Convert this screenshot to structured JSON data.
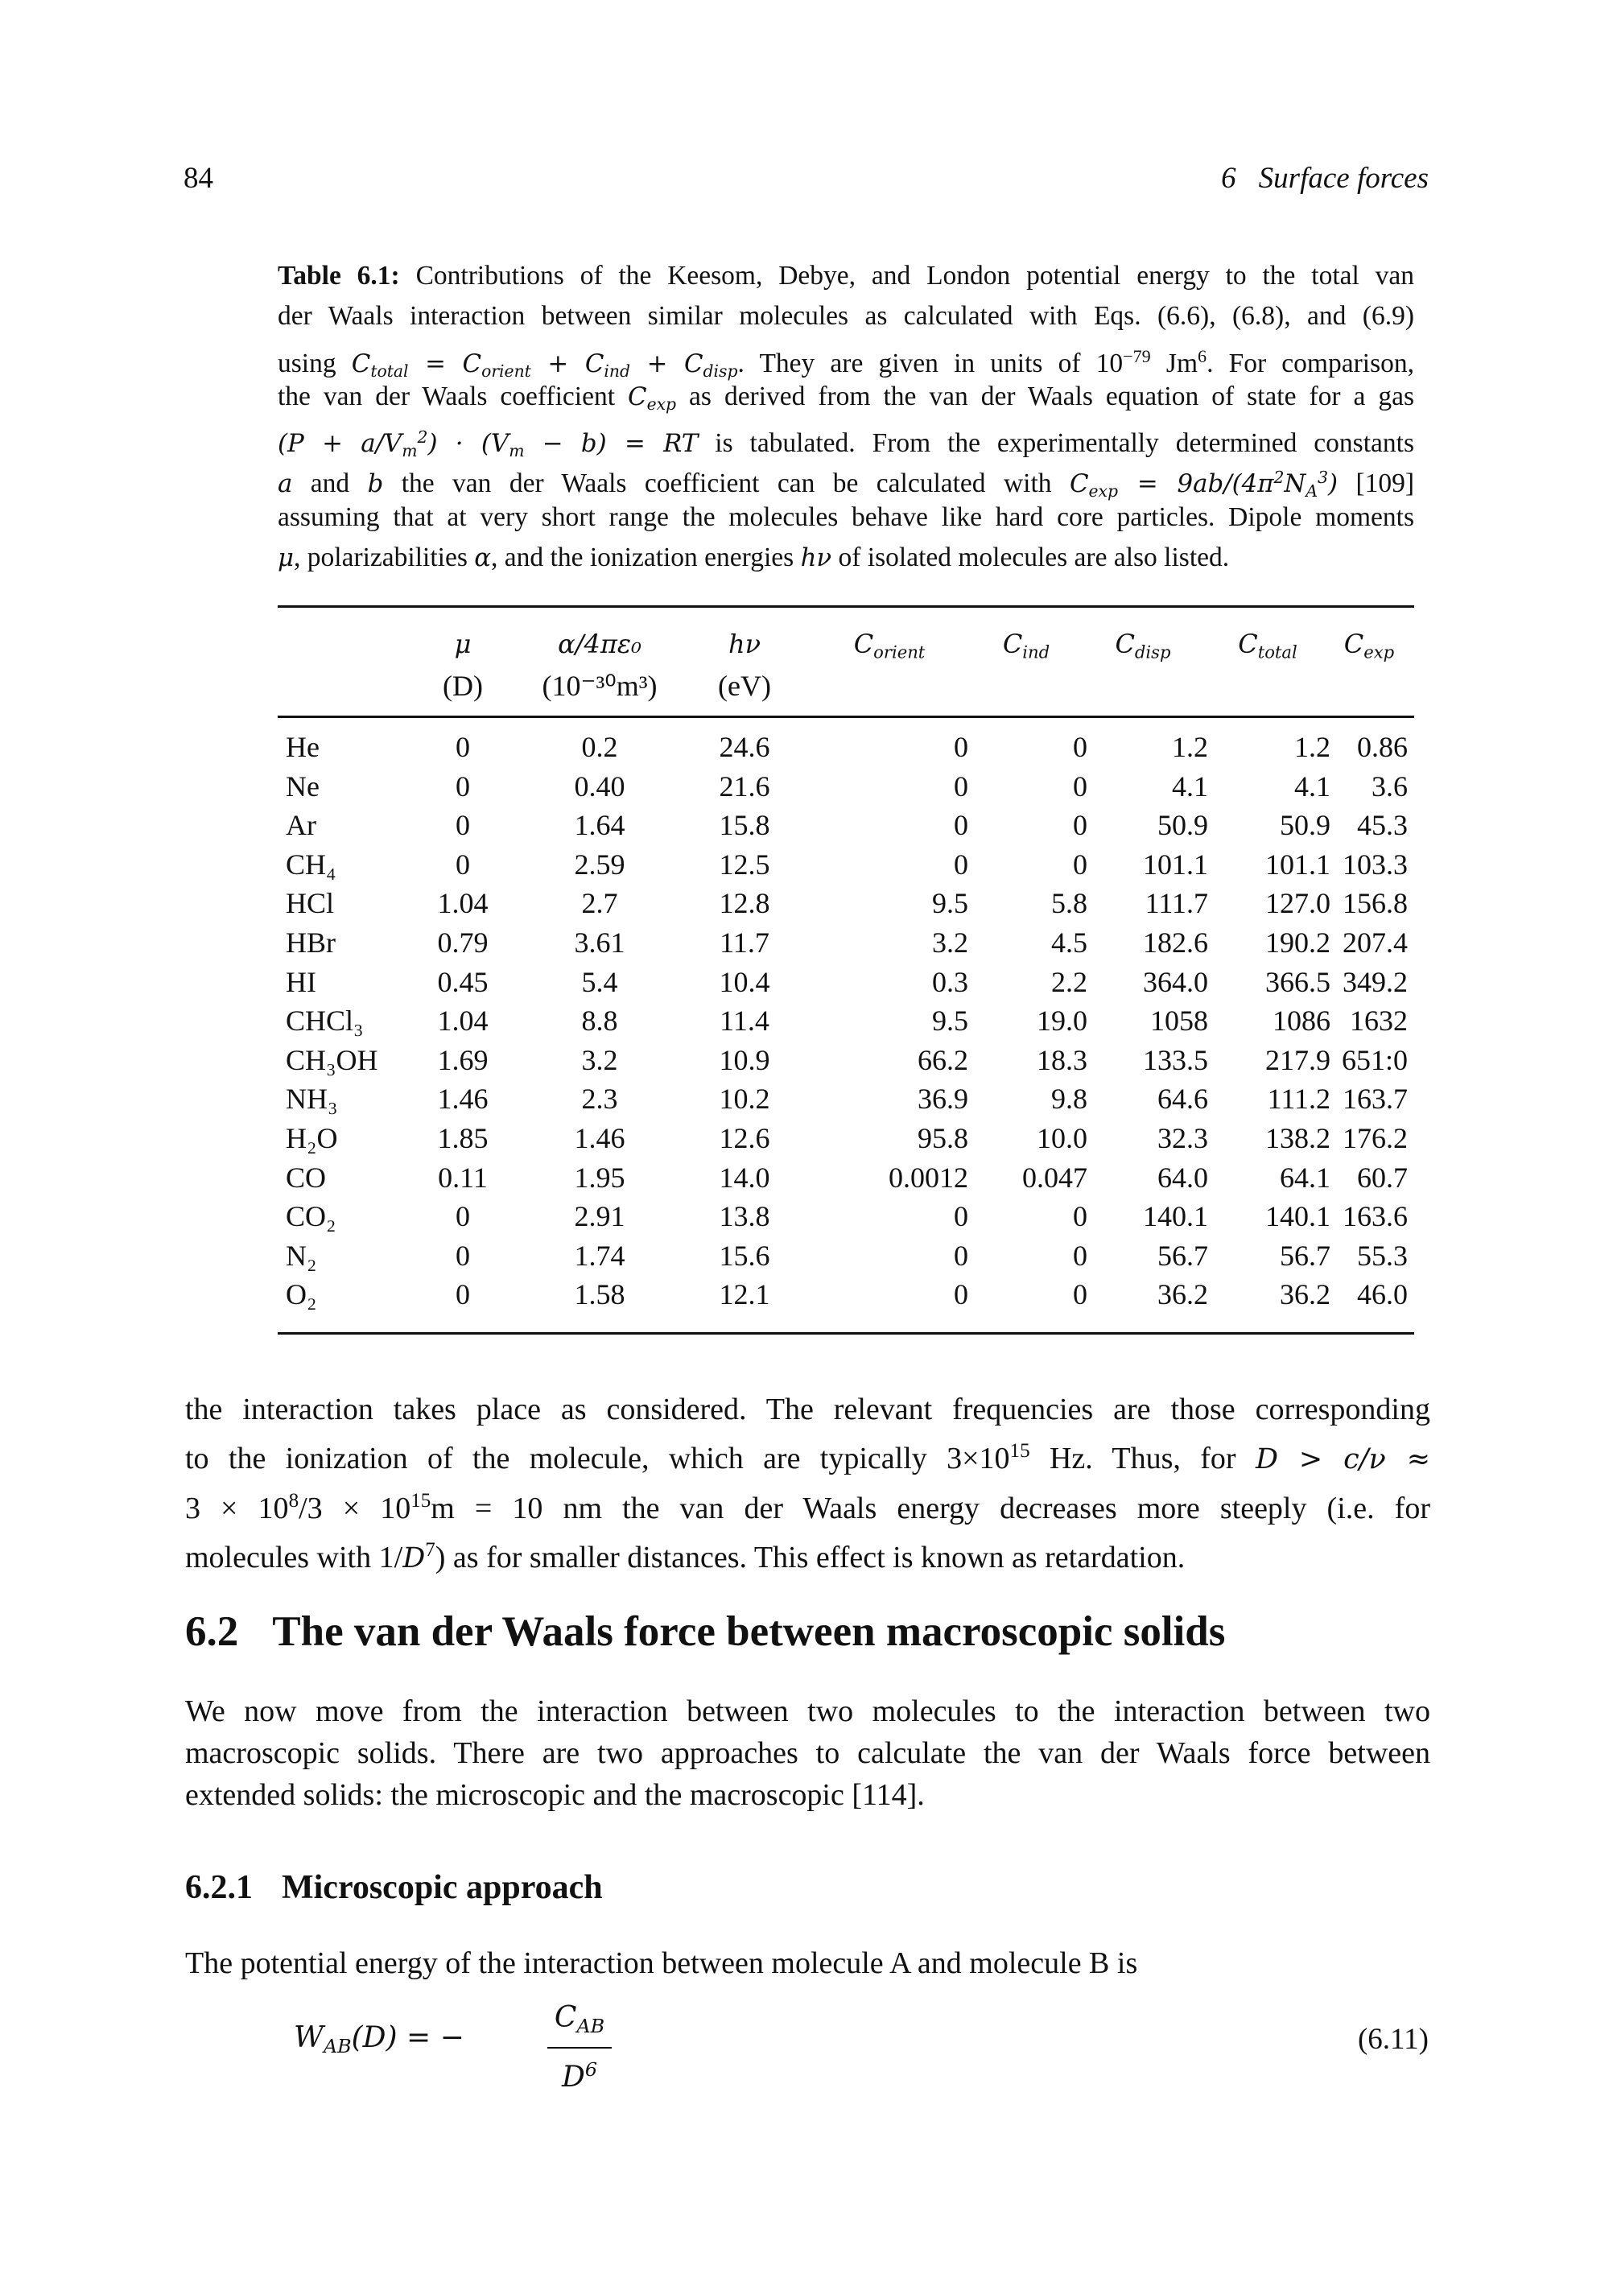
{
  "header": {
    "page_number": "84",
    "chapter_number": "6",
    "chapter_title": "Surface forces"
  },
  "caption": {
    "label": "Table 6.1:",
    "lines": [
      "Contributions of the Keesom, Debye, and London potential energy to the total van",
      "der Waals interaction between similar molecules as calculated with Eqs. (6.6), (6.8), and (6.9)",
      "using C_total = C_orient + C_ind + C_disp. They are given in units of 10^−79 Jm^6. For comparison,",
      "the van der Waals coefficient C_exp as derived from the van der Waals equation of state for a gas",
      "(P + a/V_m^2) · (V_m − b) = RT is tabulated. From the experimentally determined constants",
      "a and b the van der Waals coefficient can be calculated with C_exp = 9ab/(4π^2 N_A^3) [109]",
      "assuming that at very short range the molecules behave like hard core particles. Dipole moments",
      "μ, polarizabilities α, and the ionization energies hν of isolated molecules are also listed."
    ],
    "parts": {
      "l3_a": "using ",
      "l3_b": ". They are given in units of 10",
      "l3_exp1": "−79",
      "l3_c": " Jm",
      "l3_exp2": "6",
      "l3_d": ". For comparison,",
      "l4_a": "the van der Waals coefficient ",
      "l4_b": " as derived from the van der Waals equation of state for a gas",
      "l5_b": " is tabulated.  From the experimentally determined constants",
      "l6_a": " and ",
      "l6_b": " the van der Waals coefficient can be calculated with ",
      "l6_c": " [109]",
      "l7": "assuming that at very short range the molecules behave like hard core particles. Dipole moments",
      "l8_a": ", polarizabilities ",
      "l8_b": ", and the ionization energies ",
      "l8_c": " of isolated molecules are also listed."
    }
  },
  "table": {
    "columns": [
      {
        "symbol": "",
        "unit": ""
      },
      {
        "symbol": "μ",
        "unit": "(D)"
      },
      {
        "symbol": "α/4πε₀",
        "unit": "(10⁻³⁰m³)"
      },
      {
        "symbol": "hν",
        "unit": "(eV)"
      },
      {
        "symbol": "C",
        "sub": "orient",
        "unit": ""
      },
      {
        "symbol": "C",
        "sub": "ind",
        "unit": ""
      },
      {
        "symbol": "C",
        "sub": "disp",
        "unit": ""
      },
      {
        "symbol": "C",
        "sub": "total",
        "unit": ""
      },
      {
        "symbol": "C",
        "sub": "exp",
        "unit": ""
      }
    ],
    "rows": [
      {
        "molecule": "He",
        "mu": "0",
        "alpha": "0.2",
        "hnu": "24.6",
        "c_orient": "0",
        "c_ind": "0",
        "c_disp": "1.2",
        "c_total": "1.2",
        "c_exp": "0.86"
      },
      {
        "molecule": "Ne",
        "mu": "0",
        "alpha": "0.40",
        "hnu": "21.6",
        "c_orient": "0",
        "c_ind": "0",
        "c_disp": "4.1",
        "c_total": "4.1",
        "c_exp": "3.6"
      },
      {
        "molecule": "Ar",
        "mu": "0",
        "alpha": "1.64",
        "hnu": "15.8",
        "c_orient": "0",
        "c_ind": "0",
        "c_disp": "50.9",
        "c_total": "50.9",
        "c_exp": "45.3"
      },
      {
        "molecule": "CH₄",
        "mu": "0",
        "alpha": "2.59",
        "hnu": "12.5",
        "c_orient": "0",
        "c_ind": "0",
        "c_disp": "101.1",
        "c_total": "101.1",
        "c_exp": "103.3"
      },
      {
        "molecule": "HCl",
        "mu": "1.04",
        "alpha": "2.7",
        "hnu": "12.8",
        "c_orient": "9.5",
        "c_ind": "5.8",
        "c_disp": "111.7",
        "c_total": "127.0",
        "c_exp": "156.8"
      },
      {
        "molecule": "HBr",
        "mu": "0.79",
        "alpha": "3.61",
        "hnu": "11.7",
        "c_orient": "3.2",
        "c_ind": "4.5",
        "c_disp": "182.6",
        "c_total": "190.2",
        "c_exp": "207.4"
      },
      {
        "molecule": "HI",
        "mu": "0.45",
        "alpha": "5.4",
        "hnu": "10.4",
        "c_orient": "0.3",
        "c_ind": "2.2",
        "c_disp": "364.0",
        "c_total": "366.5",
        "c_exp": "349.2"
      },
      {
        "molecule": "CHCl₃",
        "mu": "1.04",
        "alpha": "8.8",
        "hnu": "11.4",
        "c_orient": "9.5",
        "c_ind": "19.0",
        "c_disp": "1058",
        "c_total": "1086",
        "c_exp": "1632"
      },
      {
        "molecule": "CH₃OH",
        "mu": "1.69",
        "alpha": "3.2",
        "hnu": "10.9",
        "c_orient": "66.2",
        "c_ind": "18.3",
        "c_disp": "133.5",
        "c_total": "217.9",
        "c_exp": "651:0"
      },
      {
        "molecule": "NH₃",
        "mu": "1.46",
        "alpha": "2.3",
        "hnu": "10.2",
        "c_orient": "36.9",
        "c_ind": "9.8",
        "c_disp": "64.6",
        "c_total": "111.2",
        "c_exp": "163.7"
      },
      {
        "molecule": "H₂O",
        "mu": "1.85",
        "alpha": "1.46",
        "hnu": "12.6",
        "c_orient": "95.8",
        "c_ind": "10.0",
        "c_disp": "32.3",
        "c_total": "138.2",
        "c_exp": "176.2"
      },
      {
        "molecule": "CO",
        "mu": "0.11",
        "alpha": "1.95",
        "hnu": "14.0",
        "c_orient": "0.0012",
        "c_ind": "0.047",
        "c_disp": "64.0",
        "c_total": "64.1",
        "c_exp": "60.7"
      },
      {
        "molecule": "CO₂",
        "mu": "0",
        "alpha": "2.91",
        "hnu": "13.8",
        "c_orient": "0",
        "c_ind": "0",
        "c_disp": "140.1",
        "c_total": "140.1",
        "c_exp": "163.6"
      },
      {
        "molecule": "N₂",
        "mu": "0",
        "alpha": "1.74",
        "hnu": "15.6",
        "c_orient": "0",
        "c_ind": "0",
        "c_disp": "56.7",
        "c_total": "56.7",
        "c_exp": "55.3"
      },
      {
        "molecule": "O₂",
        "mu": "0",
        "alpha": "1.58",
        "hnu": "12.1",
        "c_orient": "0",
        "c_ind": "0",
        "c_disp": "36.2",
        "c_total": "36.2",
        "c_exp": "46.0"
      }
    ]
  },
  "body": {
    "para_retardation": {
      "l1": "the interaction takes place as considered.  The relevant frequencies are those corresponding",
      "l2_a": "to the ionization of the molecule, which are typically 3×10",
      "l2_exp": "15",
      "l2_b": " Hz.  Thus, for ",
      "l2_math": "D > c/ν ≈",
      "l3_a": "3 × 10",
      "l3_exp1": "8",
      "l3_b": "/3 × 10",
      "l3_exp2": "15",
      "l3_c": "m = 10 nm the van der Waals energy decreases more steeply (i.e.  for",
      "l4_a": "molecules with 1/",
      "l4_math": "D",
      "l4_exp": "7",
      "l4_b": ") as for smaller distances. This effect is known as retardation."
    },
    "section": {
      "number": "6.2",
      "title": "The van der Waals force between macroscopic solids"
    },
    "para_approaches": {
      "l1": "We now move from the interaction between two molecules to the interaction between two",
      "l2": "macroscopic solids.  There are two approaches to calculate the van der Waals force between",
      "l3": "extended solids: the microscopic and the macroscopic [114]."
    },
    "subsection": {
      "number": "6.2.1",
      "title": "Microscopic approach"
    },
    "para_potential": "The potential energy of the interaction between molecule A and molecule B is",
    "equation": {
      "lhs": "W",
      "lhs_sub": "AB",
      "lhs_arg": "(D) = −",
      "numerator": "C",
      "numerator_sub": "AB",
      "denominator": "D",
      "denominator_exp": "6",
      "number": "(6.11)"
    }
  }
}
